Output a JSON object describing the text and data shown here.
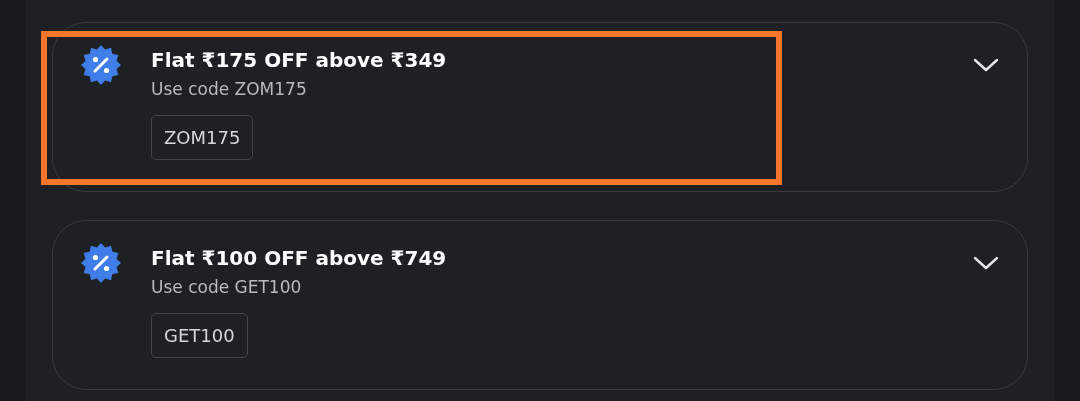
{
  "offers": [
    {
      "title": "Flat ₹175 OFF above ₹349",
      "subtitle": "Use code ZOM175",
      "code": "ZOM175",
      "highlighted": true
    },
    {
      "title": "Flat ₹100 OFF above ₹749",
      "subtitle": "Use code GET100",
      "code": "GET100",
      "highlighted": false
    }
  ]
}
